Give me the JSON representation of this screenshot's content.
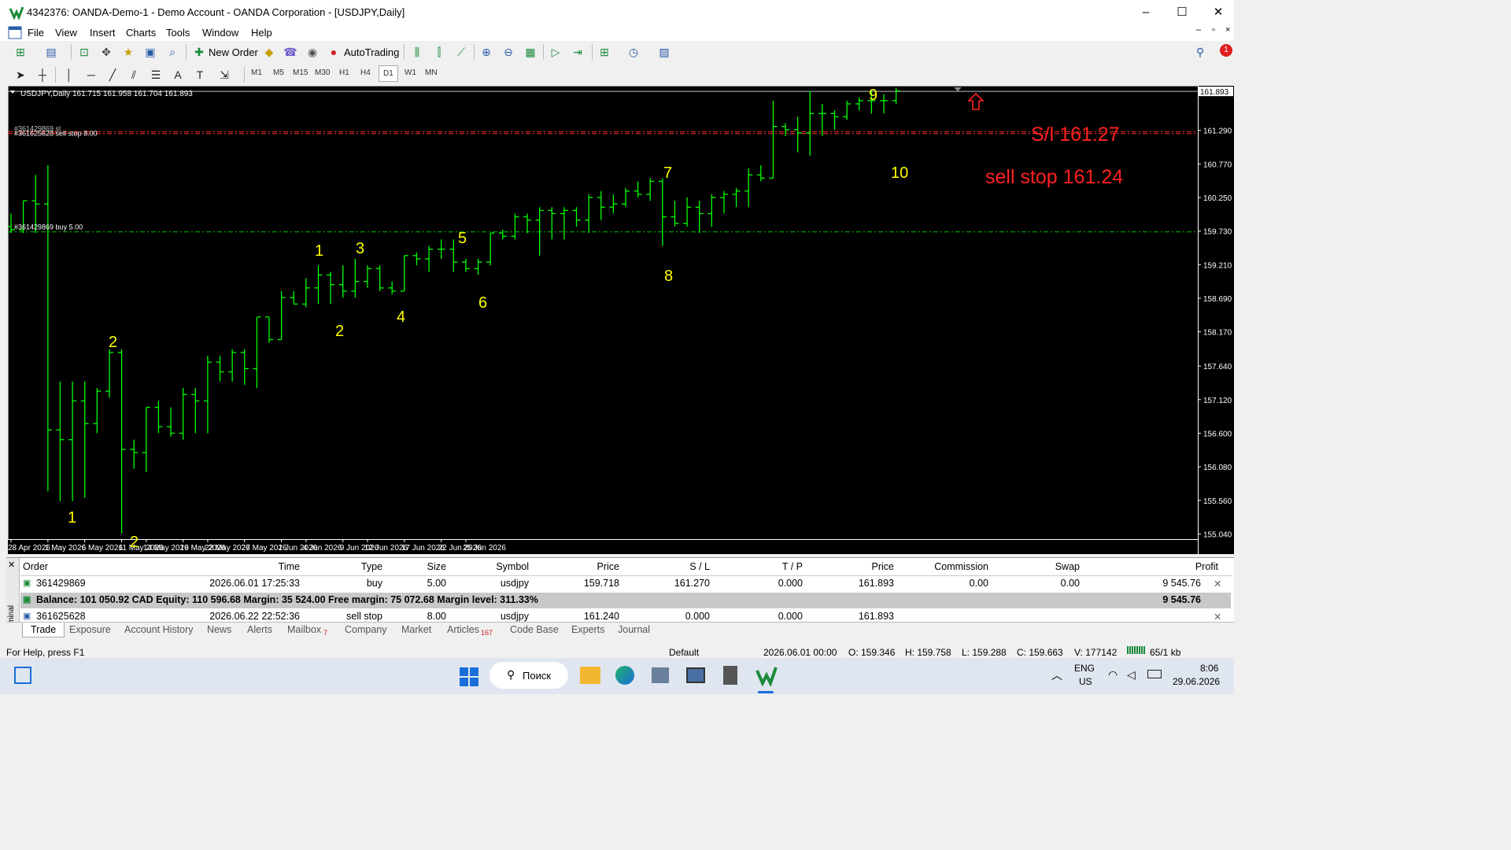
{
  "window": {
    "title": "4342376: OANDA-Demo-1 - Demo Account - OANDA Corporation - [USDJPY,Daily]",
    "controls": [
      "–",
      "☐",
      "✕"
    ],
    "mdi_controls": [
      "–",
      "▫",
      "×"
    ]
  },
  "menu": [
    "File",
    "View",
    "Insert",
    "Charts",
    "Tools",
    "Window",
    "Help"
  ],
  "toolbar": {
    "new_order": "New Order",
    "autotrading": "AutoTrading",
    "notification_count": "1"
  },
  "timeframes": [
    "M1",
    "M5",
    "M15",
    "M30",
    "H1",
    "H4",
    "D1",
    "W1",
    "MN"
  ],
  "selected_timeframe": "D1",
  "chart": {
    "header": "USDJPY,Daily  161.715 161.958 161.704 161.893",
    "current_price": "161.893",
    "order_line_sell": "#361625628 sell stop 8.00",
    "order_line_sl": "#361429869 sl",
    "order_line_buy": "#361429869 buy 5.00",
    "annotation_sl": "S/l 161.27",
    "annotation_sellstop": "sell stop 161.24",
    "price_labels": [
      "161.290",
      "160.770",
      "160.250",
      "159.730",
      "159.210",
      "158.690",
      "158.170",
      "157.640",
      "157.120",
      "156.600",
      "156.080",
      "155.560",
      "155.040"
    ],
    "date_labels": [
      "28 Apr 2026",
      "1 May 2026",
      "6 May 2026",
      "11 May 2026",
      "14 May 2026",
      "19 May 2026",
      "22 May 2026",
      "27 May 2026",
      "1 Jun 2026",
      "4 Jun 2026",
      "9 Jun 2026",
      "12 Jun 2026",
      "17 Jun 2026",
      "22 Jun 2026",
      "25 Jun 2026"
    ],
    "wave_numbers": [
      "1",
      "2",
      "1",
      "2",
      "3",
      "4",
      "5",
      "6",
      "7",
      "8",
      "9",
      "10",
      "2"
    ]
  },
  "chart_data": {
    "type": "ohlc",
    "symbol": "USDJPY",
    "timeframe": "Daily",
    "y_range": [
      155.0,
      162.0
    ],
    "candles": [
      {
        "o": 159.8,
        "h": 160.0,
        "l": 159.7,
        "c": 159.75
      },
      {
        "o": 159.75,
        "h": 160.2,
        "l": 159.7,
        "c": 160.2
      },
      {
        "o": 160.2,
        "h": 160.6,
        "l": 159.7,
        "c": 160.15
      },
      {
        "o": 160.15,
        "h": 160.75,
        "l": 155.7,
        "c": 156.65
      },
      {
        "o": 156.65,
        "h": 157.4,
        "l": 155.55,
        "c": 156.5
      },
      {
        "o": 156.5,
        "h": 157.4,
        "l": 155.55,
        "c": 157.1
      },
      {
        "o": 157.1,
        "h": 157.4,
        "l": 155.6,
        "c": 156.75
      },
      {
        "o": 156.75,
        "h": 157.3,
        "l": 156.6,
        "c": 157.25
      },
      {
        "o": 157.25,
        "h": 157.9,
        "l": 157.15,
        "c": 157.85
      },
      {
        "o": 157.85,
        "h": 157.9,
        "l": 155.05,
        "c": 156.35
      },
      {
        "o": 156.35,
        "h": 156.5,
        "l": 156.05,
        "c": 156.3
      },
      {
        "o": 156.3,
        "h": 157.0,
        "l": 156.0,
        "c": 157.0
      },
      {
        "o": 157.0,
        "h": 157.1,
        "l": 156.6,
        "c": 156.7
      },
      {
        "o": 156.7,
        "h": 157.0,
        "l": 156.55,
        "c": 156.6
      },
      {
        "o": 156.6,
        "h": 157.3,
        "l": 156.5,
        "c": 157.2
      },
      {
        "o": 157.2,
        "h": 157.3,
        "l": 156.6,
        "c": 157.1
      },
      {
        "o": 157.1,
        "h": 157.8,
        "l": 156.6,
        "c": 157.7
      },
      {
        "o": 157.7,
        "h": 157.8,
        "l": 157.4,
        "c": 157.55
      },
      {
        "o": 157.55,
        "h": 157.9,
        "l": 157.4,
        "c": 157.85
      },
      {
        "o": 157.85,
        "h": 157.9,
        "l": 157.35,
        "c": 157.6
      },
      {
        "o": 157.6,
        "h": 158.4,
        "l": 157.3,
        "c": 158.4
      },
      {
        "o": 158.4,
        "h": 158.4,
        "l": 158.0,
        "c": 158.05
      },
      {
        "o": 158.05,
        "h": 158.8,
        "l": 158.05,
        "c": 158.7
      },
      {
        "o": 158.7,
        "h": 158.8,
        "l": 158.6,
        "c": 158.6
      },
      {
        "o": 158.6,
        "h": 159.0,
        "l": 158.55,
        "c": 158.85
      },
      {
        "o": 158.85,
        "h": 159.2,
        "l": 158.6,
        "c": 159.05
      },
      {
        "o": 159.05,
        "h": 159.1,
        "l": 158.6,
        "c": 158.9
      },
      {
        "o": 158.9,
        "h": 159.2,
        "l": 158.7,
        "c": 158.8
      },
      {
        "o": 158.8,
        "h": 159.3,
        "l": 158.7,
        "c": 158.95
      },
      {
        "o": 158.95,
        "h": 159.2,
        "l": 158.85,
        "c": 159.15
      },
      {
        "o": 159.15,
        "h": 159.2,
        "l": 158.8,
        "c": 158.85
      },
      {
        "o": 158.85,
        "h": 158.95,
        "l": 158.75,
        "c": 158.8
      },
      {
        "o": 158.8,
        "h": 159.35,
        "l": 158.8,
        "c": 159.35
      },
      {
        "o": 159.35,
        "h": 159.4,
        "l": 159.2,
        "c": 159.3
      },
      {
        "o": 159.3,
        "h": 159.5,
        "l": 159.1,
        "c": 159.45
      },
      {
        "o": 159.45,
        "h": 159.6,
        "l": 159.3,
        "c": 159.45
      },
      {
        "o": 159.45,
        "h": 159.6,
        "l": 159.1,
        "c": 159.25
      },
      {
        "o": 159.25,
        "h": 159.3,
        "l": 159.1,
        "c": 159.15
      },
      {
        "o": 159.15,
        "h": 159.3,
        "l": 159.05,
        "c": 159.25
      },
      {
        "o": 159.25,
        "h": 159.7,
        "l": 159.2,
        "c": 159.7
      },
      {
        "o": 159.7,
        "h": 159.75,
        "l": 159.6,
        "c": 159.65
      },
      {
        "o": 159.65,
        "h": 160.0,
        "l": 159.6,
        "c": 159.95
      },
      {
        "o": 159.95,
        "h": 160.0,
        "l": 159.7,
        "c": 159.9
      },
      {
        "o": 159.9,
        "h": 160.1,
        "l": 159.35,
        "c": 160.05
      },
      {
        "o": 160.05,
        "h": 160.1,
        "l": 159.6,
        "c": 160.0
      },
      {
        "o": 160.0,
        "h": 160.1,
        "l": 159.6,
        "c": 160.05
      },
      {
        "o": 160.05,
        "h": 160.1,
        "l": 159.8,
        "c": 159.9
      },
      {
        "o": 159.9,
        "h": 160.3,
        "l": 159.7,
        "c": 160.25
      },
      {
        "o": 160.25,
        "h": 160.35,
        "l": 159.9,
        "c": 160.1
      },
      {
        "o": 160.1,
        "h": 160.3,
        "l": 160.0,
        "c": 160.15
      },
      {
        "o": 160.15,
        "h": 160.4,
        "l": 160.1,
        "c": 160.35
      },
      {
        "o": 160.35,
        "h": 160.5,
        "l": 160.25,
        "c": 160.3
      },
      {
        "o": 160.3,
        "h": 160.55,
        "l": 160.2,
        "c": 160.5
      },
      {
        "o": 160.5,
        "h": 160.55,
        "l": 159.5,
        "c": 159.95
      },
      {
        "o": 159.95,
        "h": 160.2,
        "l": 159.8,
        "c": 159.85
      },
      {
        "o": 159.85,
        "h": 160.25,
        "l": 159.8,
        "c": 160.1
      },
      {
        "o": 160.1,
        "h": 160.2,
        "l": 159.7,
        "c": 160.0
      },
      {
        "o": 160.0,
        "h": 160.3,
        "l": 159.8,
        "c": 160.25
      },
      {
        "o": 160.25,
        "h": 160.35,
        "l": 160.0,
        "c": 160.3
      },
      {
        "o": 160.3,
        "h": 160.4,
        "l": 160.1,
        "c": 160.35
      },
      {
        "o": 160.35,
        "h": 160.7,
        "l": 160.1,
        "c": 160.6
      },
      {
        "o": 160.6,
        "h": 160.75,
        "l": 160.5,
        "c": 160.55
      },
      {
        "o": 160.55,
        "h": 161.75,
        "l": 160.55,
        "c": 161.35
      },
      {
        "o": 161.35,
        "h": 161.4,
        "l": 161.2,
        "c": 161.3
      },
      {
        "o": 161.3,
        "h": 161.5,
        "l": 160.95,
        "c": 161.25
      },
      {
        "o": 161.25,
        "h": 161.9,
        "l": 160.9,
        "c": 161.55
      },
      {
        "o": 161.55,
        "h": 161.7,
        "l": 161.2,
        "c": 161.55
      },
      {
        "o": 161.55,
        "h": 161.6,
        "l": 161.3,
        "c": 161.5
      },
      {
        "o": 161.5,
        "h": 161.75,
        "l": 161.45,
        "c": 161.7
      },
      {
        "o": 161.7,
        "h": 161.8,
        "l": 161.6,
        "c": 161.75
      },
      {
        "o": 161.75,
        "h": 161.9,
        "l": 161.55,
        "c": 161.75
      },
      {
        "o": 161.75,
        "h": 161.85,
        "l": 161.55,
        "c": 161.75
      },
      {
        "o": 161.75,
        "h": 161.95,
        "l": 161.7,
        "c": 161.9
      }
    ],
    "horizontal_lines": [
      {
        "label": "#361625628 sell stop 8.00",
        "price": 161.24,
        "color": "#ff3030",
        "style": "dash-dot"
      },
      {
        "label": "#361429869 sl",
        "price": 161.27,
        "color": "#ff3030",
        "style": "dash-dot"
      },
      {
        "label": "#361429869 buy 5.00",
        "price": 159.718,
        "color": "#00c000",
        "style": "dash-dot"
      },
      {
        "label": "161.893",
        "price": 161.893,
        "color": "#c0c0c0",
        "style": "solid"
      }
    ],
    "colors": {
      "bars": "#00ff00",
      "background": "#000000",
      "grid_text": "#ffffff",
      "annotation": "#ff2020",
      "wave_numbers": "#ffff00"
    }
  },
  "terminal": {
    "side_label": "Terminal",
    "headers": [
      "Order",
      "Time",
      "Type",
      "Size",
      "Symbol",
      "Price",
      "S / L",
      "T / P",
      "Price",
      "Commission",
      "Swap",
      "Profit"
    ],
    "rows": [
      {
        "order": "361429869",
        "time": "2026.06.01 17:25:33",
        "type": "buy",
        "size": "5.00",
        "symbol": "usdjpy",
        "price": "159.718",
        "sl": "161.270",
        "tp": "0.000",
        "cur": "161.893",
        "commission": "0.00",
        "swap": "0.00",
        "profit": "9 545.76"
      },
      {
        "order": "361625628",
        "time": "2026.06.22 22:52:36",
        "type": "sell stop",
        "size": "8.00",
        "symbol": "usdjpy",
        "price": "161.240",
        "sl": "0.000",
        "tp": "0.000",
        "cur": "161.893",
        "commission": "",
        "swap": "",
        "profit": ""
      }
    ],
    "balance_line": "Balance: 101 050.92 CAD  Equity: 110 596.68  Margin: 35 524.00  Free margin: 75 072.68  Margin level: 311.33%",
    "balance_profit": "9 545.76",
    "tabs": [
      "Trade",
      "Exposure",
      "Account History",
      "News",
      "Alerts",
      "Mailbox",
      "Company",
      "Market",
      "Articles",
      "Code Base",
      "Experts",
      "Journal"
    ],
    "mailbox_badge": "7",
    "articles_badge": "167",
    "active_tab": "Trade"
  },
  "statusbar": {
    "help": "For Help, press F1",
    "profile": "Default",
    "datetime": "2026.06.01 00:00",
    "open": "O: 159.346",
    "high": "H: 159.758",
    "low": "L: 159.288",
    "close": "C: 159.663",
    "volume": "V: 177142",
    "traffic": "65/1 kb"
  },
  "taskbar": {
    "search": "Поиск",
    "lang": "ENG",
    "region": "US",
    "time": "8:06",
    "date": "29.06.2026"
  }
}
